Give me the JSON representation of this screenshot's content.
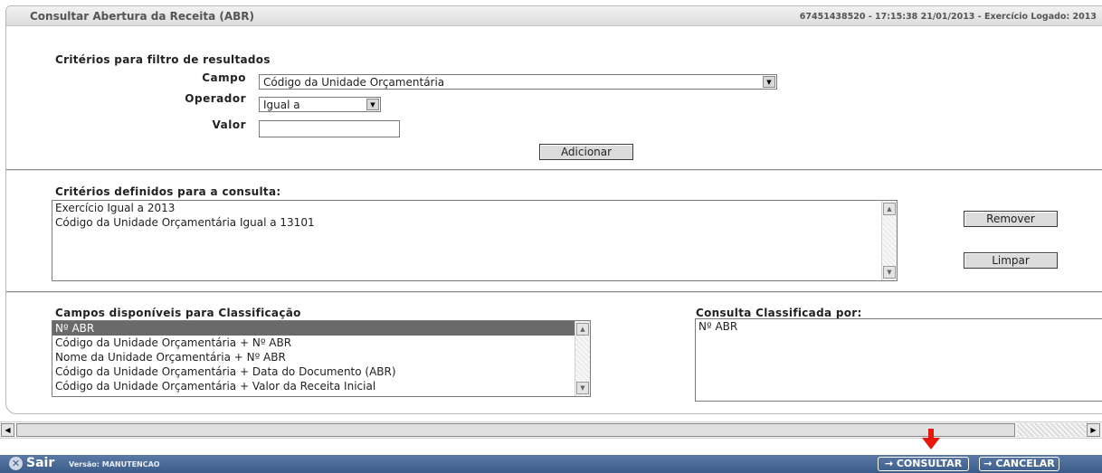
{
  "header": {
    "title": "Consultar Abertura da Receita (ABR)",
    "session_info": "67451438520 - 17:15:38 21/01/2013 - Exercício Logado: 2013"
  },
  "filter": {
    "section_title": "Critérios para filtro de resultados",
    "field_label": "Campo",
    "field_value": "Código da Unidade Orçamentária",
    "operator_label": "Operador",
    "operator_value": "Igual a",
    "value_label": "Valor",
    "value_value": "",
    "add_button": "Adicionar"
  },
  "criteria": {
    "section_title": "Critérios definidos para a consulta:",
    "items": [
      "Exercício Igual a 2013",
      "Código da Unidade Orçamentária Igual a 13101"
    ],
    "remove_button": "Remover",
    "clear_button": "Limpar"
  },
  "sorting": {
    "available_title": "Campos disponíveis para Classificação",
    "available_items": [
      "Nº ABR",
      "Código da Unidade Orçamentária + Nº ABR",
      "Nome da Unidade Orçamentária + Nº ABR",
      "Código da Unidade Orçamentária + Data do Documento (ABR)",
      "Código da Unidade Orçamentária + Valor da Receita Inicial"
    ],
    "selected_index": 0,
    "sorted_title": "Consulta Classificada por:",
    "sorted_items": [
      "Nº ABR"
    ]
  },
  "footer": {
    "logout_label": "Sair",
    "version_label": "Versão: MANUTENCAO",
    "consult_button": "→ CONSULTAR",
    "cancel_button": "→ CANCELAR"
  },
  "icons": {
    "logout": "close-circle-icon",
    "dropdown": "triangle-down-icon",
    "scroll_up": "triangle-up-icon",
    "scroll_down": "triangle-down-icon",
    "scroll_left": "triangle-left-icon",
    "scroll_right": "triangle-right-icon",
    "annotation": "red-arrow-down-icon"
  },
  "colors": {
    "bottom_bar": "#4a6a97",
    "selected_item": "#6a6a6a",
    "annotation_arrow": "#e8180c"
  }
}
